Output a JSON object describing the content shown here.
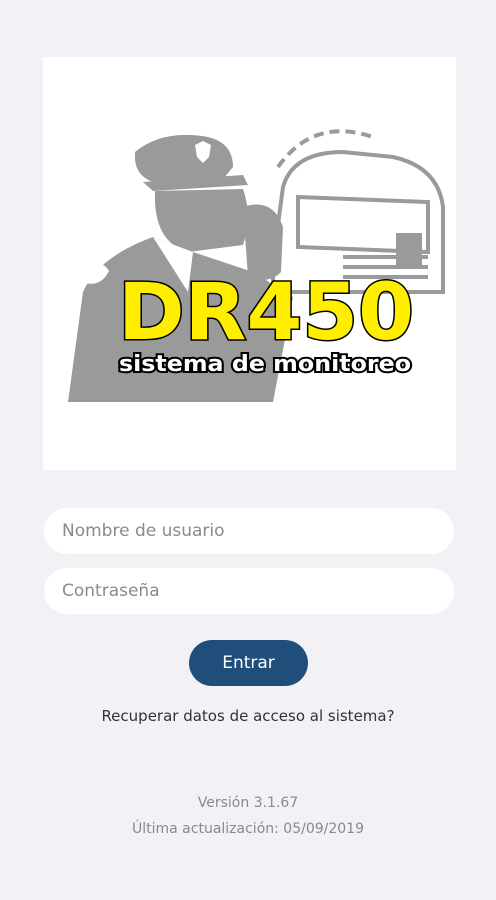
{
  "logo": {
    "brand_text": "DR450",
    "tagline_text": "sistema de monitoreo",
    "brand_fill_color": "#ffee00",
    "figure_color": "#9a9a9a"
  },
  "login": {
    "username_placeholder": "Nombre de usuario",
    "password_placeholder": "Contraseña",
    "submit_label": "Entrar",
    "submit_color": "#1f4e7a"
  },
  "recover_link_label": "Recuperar datos de acceso al sistema?",
  "footer": {
    "version": "Versión 3.1.67",
    "last_update": "Última actualización: 05/09/2019"
  }
}
